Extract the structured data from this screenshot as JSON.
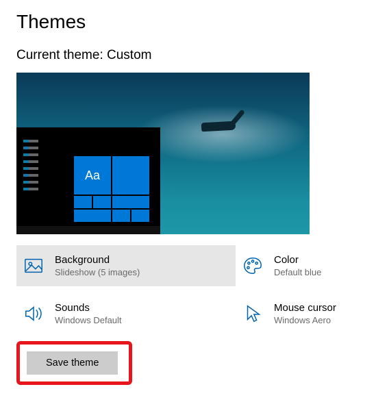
{
  "title": "Themes",
  "subtitle": "Current theme: Custom",
  "preview_tile_label": "Aa",
  "options": {
    "background": {
      "label": "Background",
      "value": "Slideshow (5 images)"
    },
    "color": {
      "label": "Color",
      "value": "Default blue"
    },
    "sounds": {
      "label": "Sounds",
      "value": "Windows Default"
    },
    "cursor": {
      "label": "Mouse cursor",
      "value": "Windows Aero"
    }
  },
  "save_button": "Save theme"
}
